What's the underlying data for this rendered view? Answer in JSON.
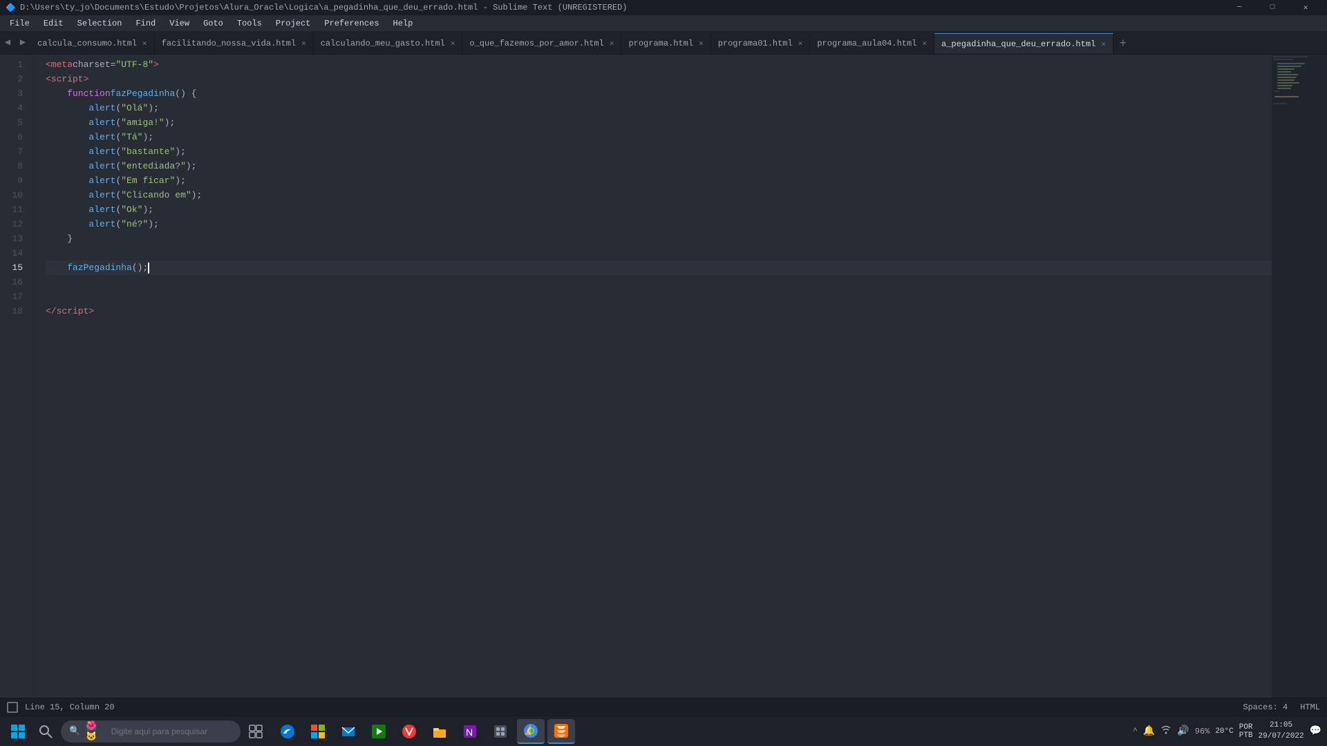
{
  "titlebar": {
    "path": "D:\\Users\\ty_jo\\Documents\\Estudo\\Projetos\\Alura_Oracle\\Logica\\a_pegadinha_que_deu_errado.html - Sublime Text (UNREGISTERED)",
    "minimize": "─",
    "maximize": "□",
    "close": "✕"
  },
  "menubar": {
    "items": [
      "File",
      "Edit",
      "Selection",
      "Find",
      "View",
      "Goto",
      "Tools",
      "Project",
      "Preferences",
      "Help"
    ]
  },
  "tabs": [
    {
      "label": "calcula_consumo.html",
      "active": false
    },
    {
      "label": "facilitando_nossa_vida.html",
      "active": false
    },
    {
      "label": "calculando_meu_gasto.html",
      "active": false
    },
    {
      "label": "o_que_fazemos_por_amor.html",
      "active": false
    },
    {
      "label": "programa.html",
      "active": false
    },
    {
      "label": "programa01.html",
      "active": false
    },
    {
      "label": "programa_aula04.html",
      "active": false
    },
    {
      "label": "a_pegadinha_que_deu_errado.html",
      "active": true
    }
  ],
  "statusbar": {
    "line_col": "Line 15, Column 20",
    "spaces": "Spaces: 4",
    "encoding": "HTML"
  },
  "taskbar": {
    "search_placeholder": "Digite aqui para pesquisar",
    "time": "21:05",
    "date": "29/07/2022",
    "lang": "POR",
    "sublang": "PTB",
    "temp": "20°C",
    "battery": "96%"
  }
}
